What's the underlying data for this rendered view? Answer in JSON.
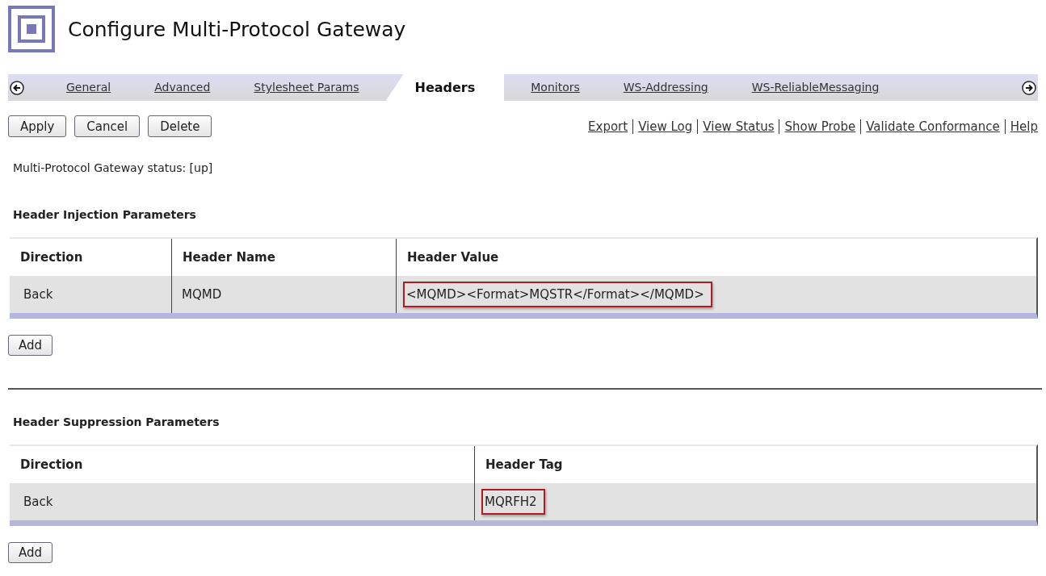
{
  "page": {
    "title": "Configure Multi-Protocol Gateway"
  },
  "tabs": [
    {
      "label": "General",
      "selected": false
    },
    {
      "label": "Advanced",
      "selected": false
    },
    {
      "label": "Stylesheet Params",
      "selected": false
    },
    {
      "label": "Headers",
      "selected": true
    },
    {
      "label": "Monitors",
      "selected": false
    },
    {
      "label": "WS-Addressing",
      "selected": false
    },
    {
      "label": "WS-ReliableMessaging",
      "selected": false
    }
  ],
  "actions": [
    "Apply",
    "Cancel",
    "Delete"
  ],
  "links": [
    "Export",
    "View Log",
    "View Status",
    "Show Probe",
    "Validate Conformance",
    "Help"
  ],
  "status": "Multi-Protocol Gateway status: [up]",
  "sections": [
    {
      "heading": "Header Injection Parameters",
      "columns": [
        "Direction",
        "Header Name",
        "Header Value"
      ],
      "rows": [
        [
          {
            "text": "Back",
            "highlighted": false
          },
          {
            "text": "MQMD",
            "highlighted": false
          },
          {
            "text": "<MQMD><Format>MQSTR</Format></MQMD>",
            "highlighted": true
          }
        ]
      ],
      "add_button": "Add"
    },
    {
      "heading": "Header Suppression Parameters",
      "columns": [
        "Direction",
        "Header Tag"
      ],
      "rows": [
        [
          {
            "text": "Back",
            "highlighted": false
          },
          {
            "text": "MQRFH2",
            "highlighted": true
          }
        ]
      ],
      "add_button": "Add"
    }
  ]
}
